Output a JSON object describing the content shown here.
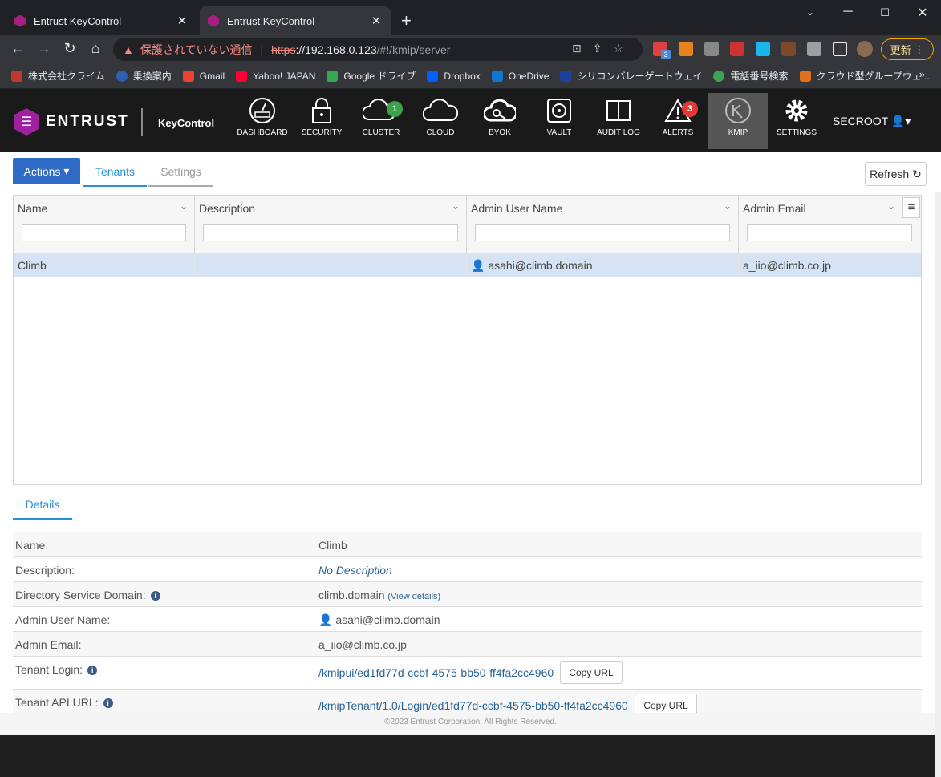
{
  "browser": {
    "tabs": [
      {
        "title": "Entrust KeyControl",
        "active": false
      },
      {
        "title": "Entrust KeyControl",
        "active": true
      }
    ],
    "new_tab": "+",
    "address": {
      "security_label": "保護されていない通信",
      "scheme": "https",
      "host": "://192.168.0.123",
      "path": "/#!/kmip/server"
    },
    "update_label": "更新",
    "ext_badge": "3",
    "bookmarks": [
      "株式会社クライム",
      "乗換案内",
      "Gmail",
      "Yahoo! JAPAN",
      "Google ドライブ",
      "Dropbox",
      "OneDrive",
      "シリコンバレーゲートウェイ",
      "電話番号検索",
      "クラウド型グループウェ..."
    ],
    "bookmarks_more": "»"
  },
  "app": {
    "brand": "ENTRUST",
    "product": "KeyControl",
    "nav": [
      {
        "label": "DASHBOARD",
        "icon": "dashboard-icon"
      },
      {
        "label": "SECURITY",
        "icon": "lock-icon"
      },
      {
        "label": "CLUSTER",
        "icon": "cluster-icon",
        "badge": "1"
      },
      {
        "label": "CLOUD",
        "icon": "cloud-icon"
      },
      {
        "label": "BYOK",
        "icon": "key-cloud-icon"
      },
      {
        "label": "VAULT",
        "icon": "vault-icon"
      },
      {
        "label": "AUDIT LOG",
        "icon": "book-icon"
      },
      {
        "label": "ALERTS",
        "icon": "alert-icon",
        "badge": "3"
      },
      {
        "label": "KMIP",
        "icon": "kmip-icon",
        "active": true
      },
      {
        "label": "SETTINGS",
        "icon": "gear-icon"
      }
    ],
    "user": "SECROOT",
    "actions_label": "Actions",
    "tabs": [
      "Tenants",
      "Settings"
    ],
    "refresh_label": "Refresh",
    "grid": {
      "columns": [
        "Name",
        "Description",
        "Admin User Name",
        "Admin Email"
      ],
      "rows": [
        {
          "name": "Climb",
          "description": "",
          "admin_user": "asahi@climb.domain",
          "admin_email": "a_iio@climb.co.jp"
        }
      ]
    },
    "details_tab": "Details",
    "details": {
      "name_label": "Name:",
      "name": "Climb",
      "description_label": "Description:",
      "description": "No Description",
      "dsd_label": "Directory Service Domain:",
      "dsd": "climb.domain",
      "dsd_link": "(View details)",
      "admin_user_label": "Admin User Name:",
      "admin_user": "asahi@climb.domain",
      "admin_email_label": "Admin Email:",
      "admin_email": "a_iio@climb.co.jp",
      "login_label": "Tenant Login:",
      "login_url": "/kmipui/ed1fd77d-ccbf-4575-bb50-ff4fa2cc4960",
      "api_label": "Tenant API URL:",
      "api_url": "/kmipTenant/1.0/Login/ed1fd77d-ccbf-4575-bb50-ff4fa2cc4960",
      "copy_label": "Copy URL"
    },
    "footer": "©2023 Entrust Corporation. All Rights Reserved."
  }
}
